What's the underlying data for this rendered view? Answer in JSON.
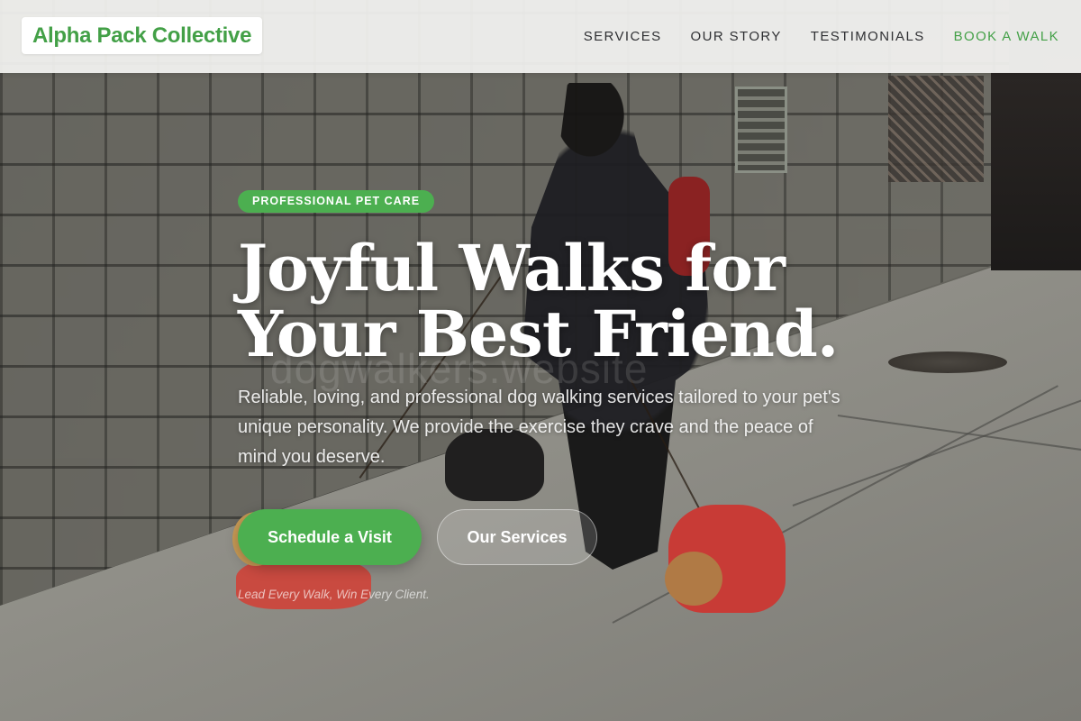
{
  "brand": {
    "name": "Alpha Pack Collective",
    "color": "#43a047"
  },
  "nav": {
    "items": [
      {
        "label": "SERVICES",
        "accent": false
      },
      {
        "label": "OUR STORY",
        "accent": false
      },
      {
        "label": "TESTIMONIALS",
        "accent": false
      },
      {
        "label": "BOOK A WALK",
        "accent": true
      }
    ]
  },
  "hero": {
    "badge": "PROFESSIONAL PET CARE",
    "headline_line1": "Joyful Walks for",
    "headline_line2": "Your Best Friend.",
    "subtext": "Reliable, loving, and professional dog walking services tailored to your pet's unique personality. We provide the exercise they crave and the peace of mind you deserve.",
    "primary_cta": "Schedule a Visit",
    "secondary_cta": "Our Services",
    "tagline": "Lead Every Walk, Win Every Client.",
    "watermark": "dogwalkers.website",
    "background_image": "woman-walking-three-dogs-on-sidewalk"
  },
  "colors": {
    "accent": "#4caf50",
    "nav_text": "#2f3033",
    "nav_background": "#f4f4f2"
  }
}
